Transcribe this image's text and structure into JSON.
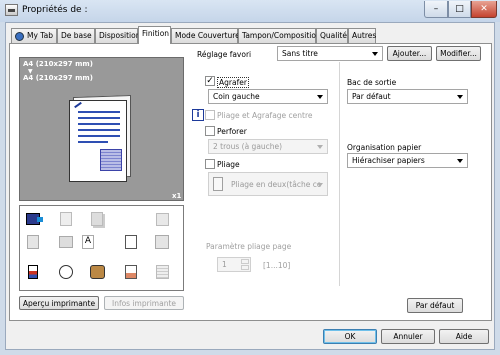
{
  "window": {
    "title": "Propriétés de :",
    "close_glyph": "✕",
    "max_glyph": "□",
    "min_glyph": "–"
  },
  "tabs": [
    {
      "label": "My Tab"
    },
    {
      "label": "De base"
    },
    {
      "label": "Disposition"
    },
    {
      "label": "Finition"
    },
    {
      "label": "Mode Couverture"
    },
    {
      "label": "Tampon/Composition"
    },
    {
      "label": "Qualité"
    },
    {
      "label": "Autres"
    }
  ],
  "active_tab": "Finition",
  "preview": {
    "paper_size": "A4 (210x297 mm)",
    "paper_size_2": "A4 (210x297 mm)",
    "down_arrow": "▼",
    "copies": "x1"
  },
  "favorite": {
    "label": "Réglage favori",
    "value": "Sans titre",
    "add_button": "Ajouter...",
    "edit_button": "Modifier..."
  },
  "staple": {
    "label": "Agrafer",
    "checked": true,
    "value": "Coin gauche"
  },
  "fold_staple": {
    "label": "Pliage et Agrafage centre",
    "checked": false
  },
  "punch": {
    "label": "Perforer",
    "checked": false,
    "value": "2 trous (à gauche)"
  },
  "fold": {
    "label": "Pliage",
    "checked": false,
    "value": "Pliage en deux(tâche co"
  },
  "fold_page": {
    "label": "Paramètre pliage page",
    "value": "1",
    "range": "[1...10]"
  },
  "output_tray": {
    "label": "Bac de sortie",
    "value": "Par défaut"
  },
  "paper_arrangement": {
    "label": "Organisation papier",
    "value": "Hiérachiser papiers"
  },
  "buttons": {
    "print_preview": "Aperçu imprimante",
    "printer_info": "Infos imprimante",
    "defaults": "Par défaut",
    "ok": "OK",
    "cancel": "Annuler",
    "help": "Aide"
  },
  "info_icon_glyph": "i",
  "check_glyph": "✓"
}
